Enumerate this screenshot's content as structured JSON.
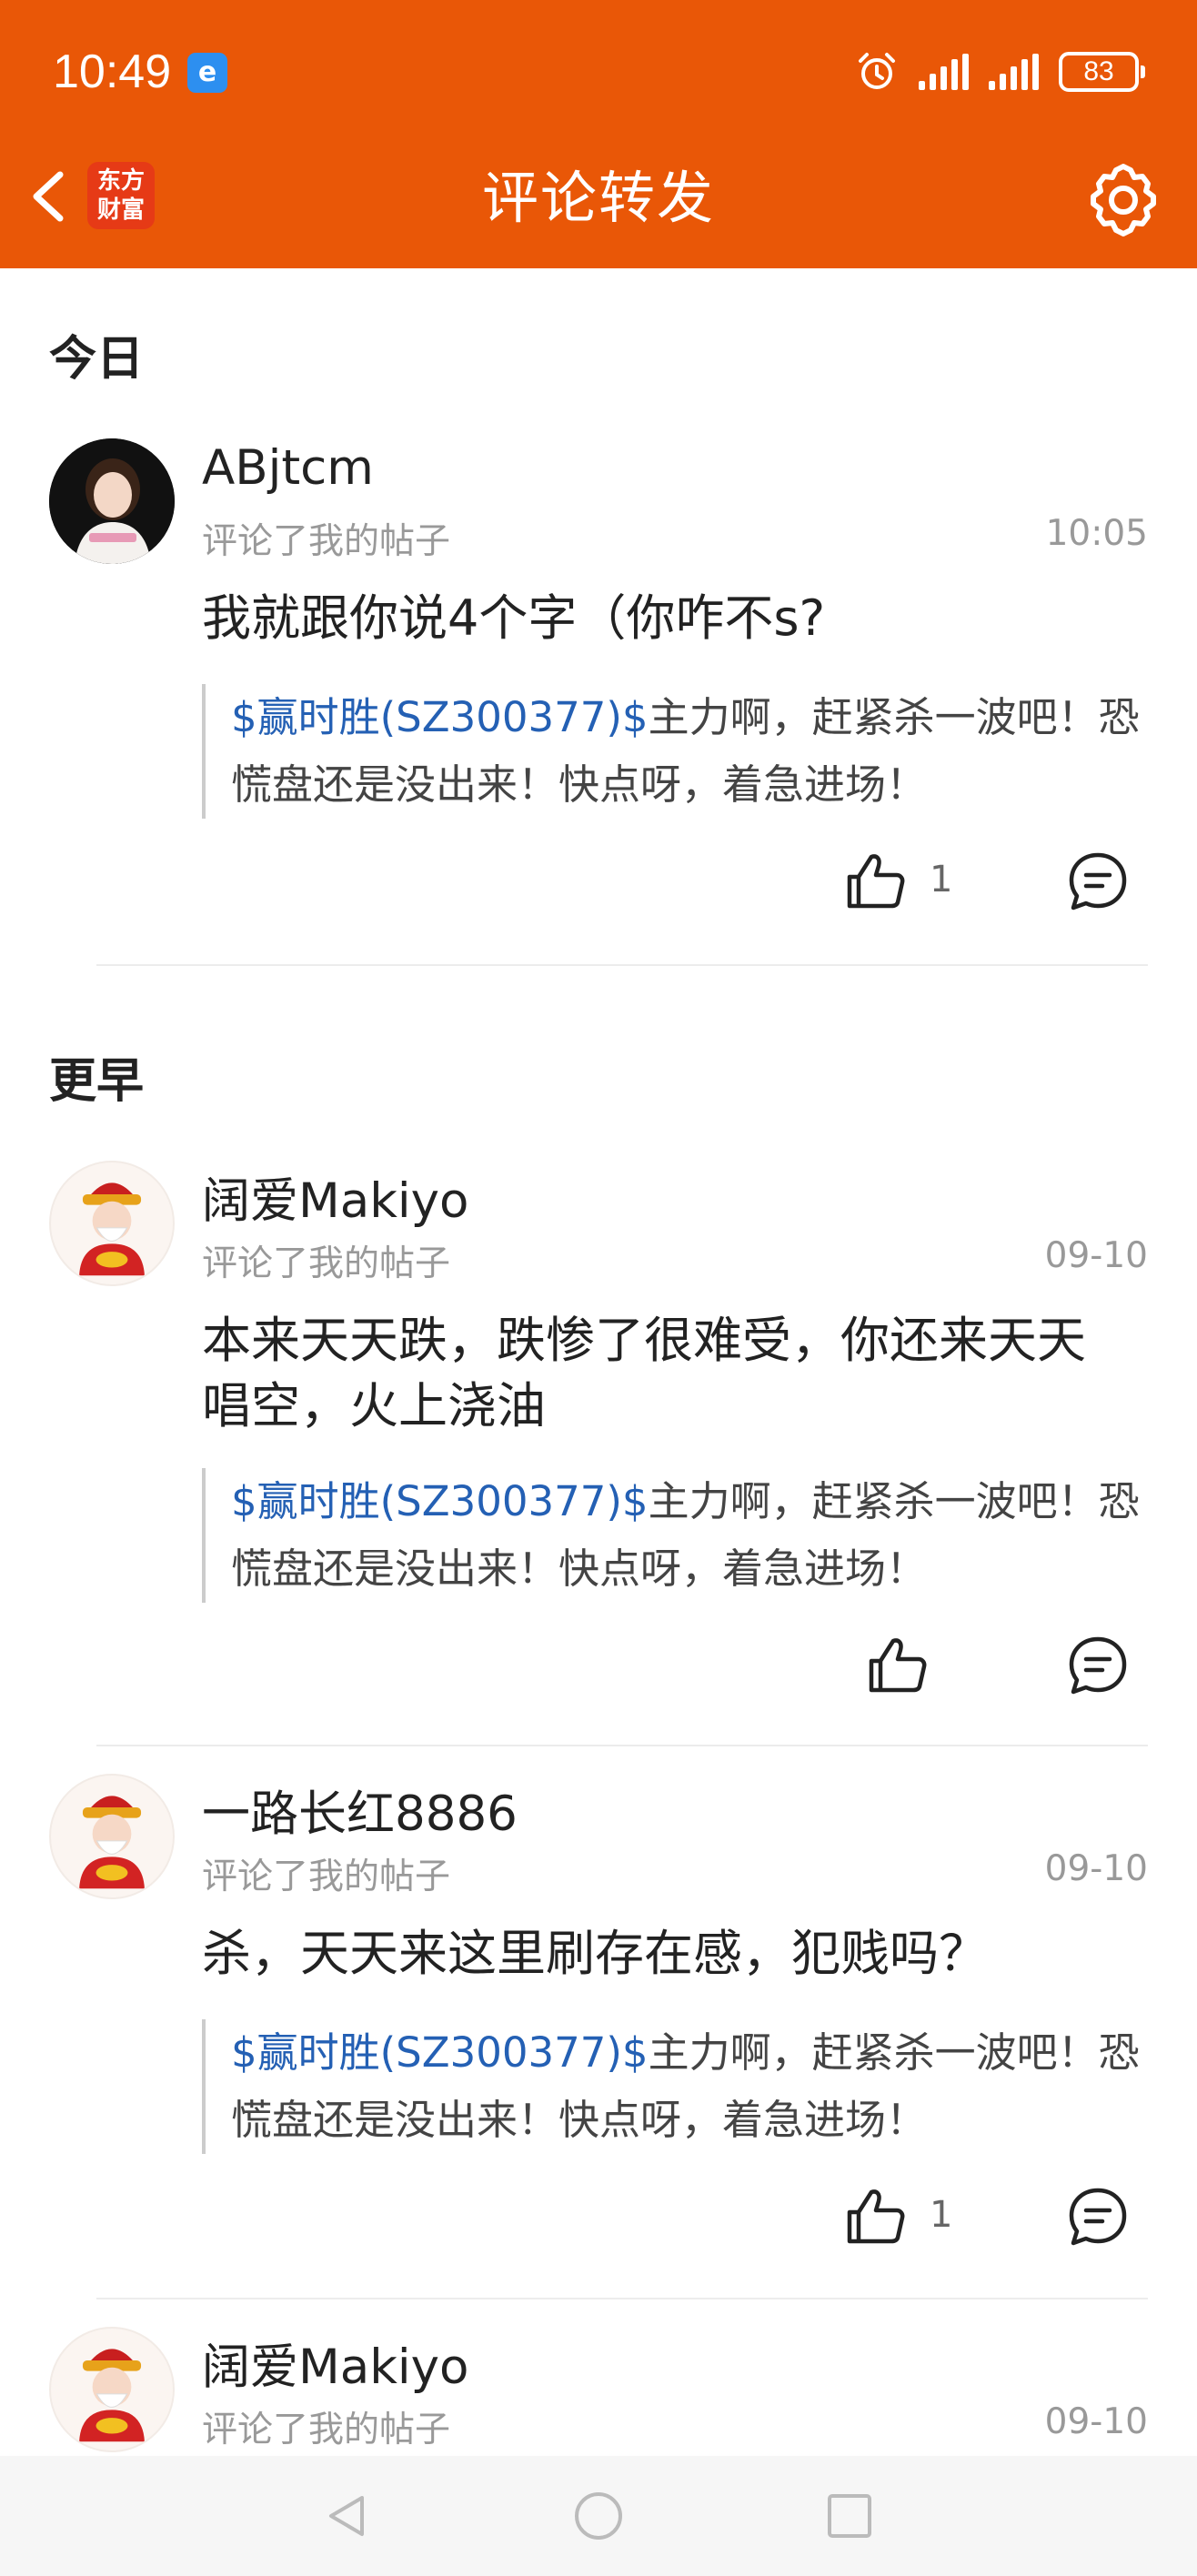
{
  "status_bar": {
    "time": "10:49",
    "battery": "83"
  },
  "header": {
    "title": "评论转发",
    "logo_line1": "东方",
    "logo_line2": "财富"
  },
  "sections": {
    "today": "今日",
    "earlier": "更早"
  },
  "items": [
    {
      "username": "ABjtcm",
      "action": "评论了我的帖子",
      "time": "10:05",
      "comment": "我就跟你说4个字（你咋不s?",
      "quote_stock": "$赢时胜(SZ300377)$",
      "quote_rest": "主力啊，赶紧杀一波吧！恐慌盘还是没出来！快点呀，着急进场！",
      "likes": "1"
    },
    {
      "username": "阔爱Makiyo",
      "action": "评论了我的帖子",
      "time": "09-10",
      "comment": "本来天天跌，跌惨了很难受，你还来天天唱空，火上浇油",
      "quote_stock": "$赢时胜(SZ300377)$",
      "quote_rest": "主力啊，赶紧杀一波吧！恐慌盘还是没出来！快点呀，着急进场！",
      "likes": ""
    },
    {
      "username": "一路长红8886",
      "action": "评论了我的帖子",
      "time": "09-10",
      "comment": "杀，天天来这里刷存在感，犯贱吗？",
      "quote_stock": "$赢时胜(SZ300377)$",
      "quote_rest": "主力啊，赶紧杀一波吧！恐慌盘还是没出来！快点呀，着急进场！",
      "likes": "1"
    },
    {
      "username": "阔爱Makiyo",
      "action": "评论了我的帖子",
      "time": "09-10"
    }
  ],
  "colors": {
    "brand": "#e95707",
    "link": "#2460b4"
  },
  "icons": {
    "back": "chevron-left-icon",
    "settings": "gear-icon",
    "like": "thumbs-up-icon",
    "reply": "comment-bubble-icon",
    "nav_back": "triangle-back-icon",
    "nav_home": "circle-home-icon",
    "nav_recent": "square-recent-icon"
  }
}
